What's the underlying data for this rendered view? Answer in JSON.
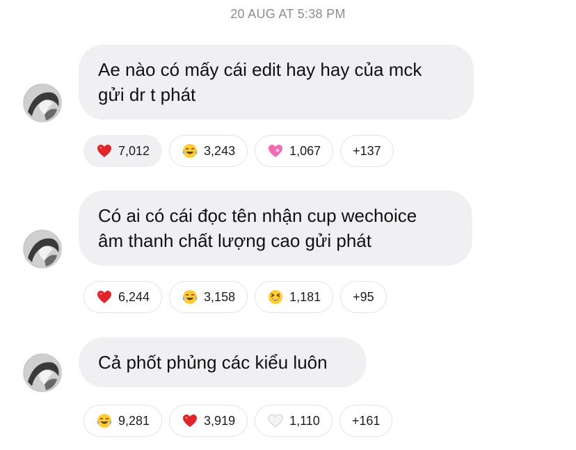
{
  "timestamp": "20 AUG AT 5:38 PM",
  "messages": [
    {
      "lines": [
        "Ae nào có mấy cái edit hay hay của mck",
        "gửi dr t phát"
      ],
      "reactions": [
        {
          "icon": "red-heart",
          "count": "7,012",
          "active": true
        },
        {
          "icon": "tears-of-joy",
          "count": "3,243",
          "active": false
        },
        {
          "icon": "pink-heart",
          "count": "1,067",
          "active": false
        },
        {
          "icon": "",
          "count": "+137",
          "active": false
        }
      ]
    },
    {
      "lines": [
        "Có ai có cái đọc tên nhận cup wechoice",
        "âm thanh chất lượng cao gửi phát"
      ],
      "reactions": [
        {
          "icon": "red-heart",
          "count": "6,244",
          "active": false
        },
        {
          "icon": "tears-of-joy",
          "count": "3,158",
          "active": false
        },
        {
          "icon": "grinning-squinting",
          "count": "1,181",
          "active": false
        },
        {
          "icon": "",
          "count": "+95",
          "active": false
        }
      ]
    },
    {
      "lines": [
        "Cả phốt phủng các kiểu luôn"
      ],
      "reactions": [
        {
          "icon": "tears-of-joy",
          "count": "9,281",
          "active": false
        },
        {
          "icon": "red-heart",
          "count": "3,919",
          "active": false
        },
        {
          "icon": "white-heart",
          "count": "1,110",
          "active": false
        },
        {
          "icon": "",
          "count": "+161",
          "active": false
        }
      ]
    }
  ],
  "colors": {
    "bubble": "#f0f0f2",
    "timestamp": "#8a8d91",
    "red_heart": "#e0242b",
    "pink_heart": "#f06ab4",
    "emoji_yellow": "#ffcc33"
  }
}
